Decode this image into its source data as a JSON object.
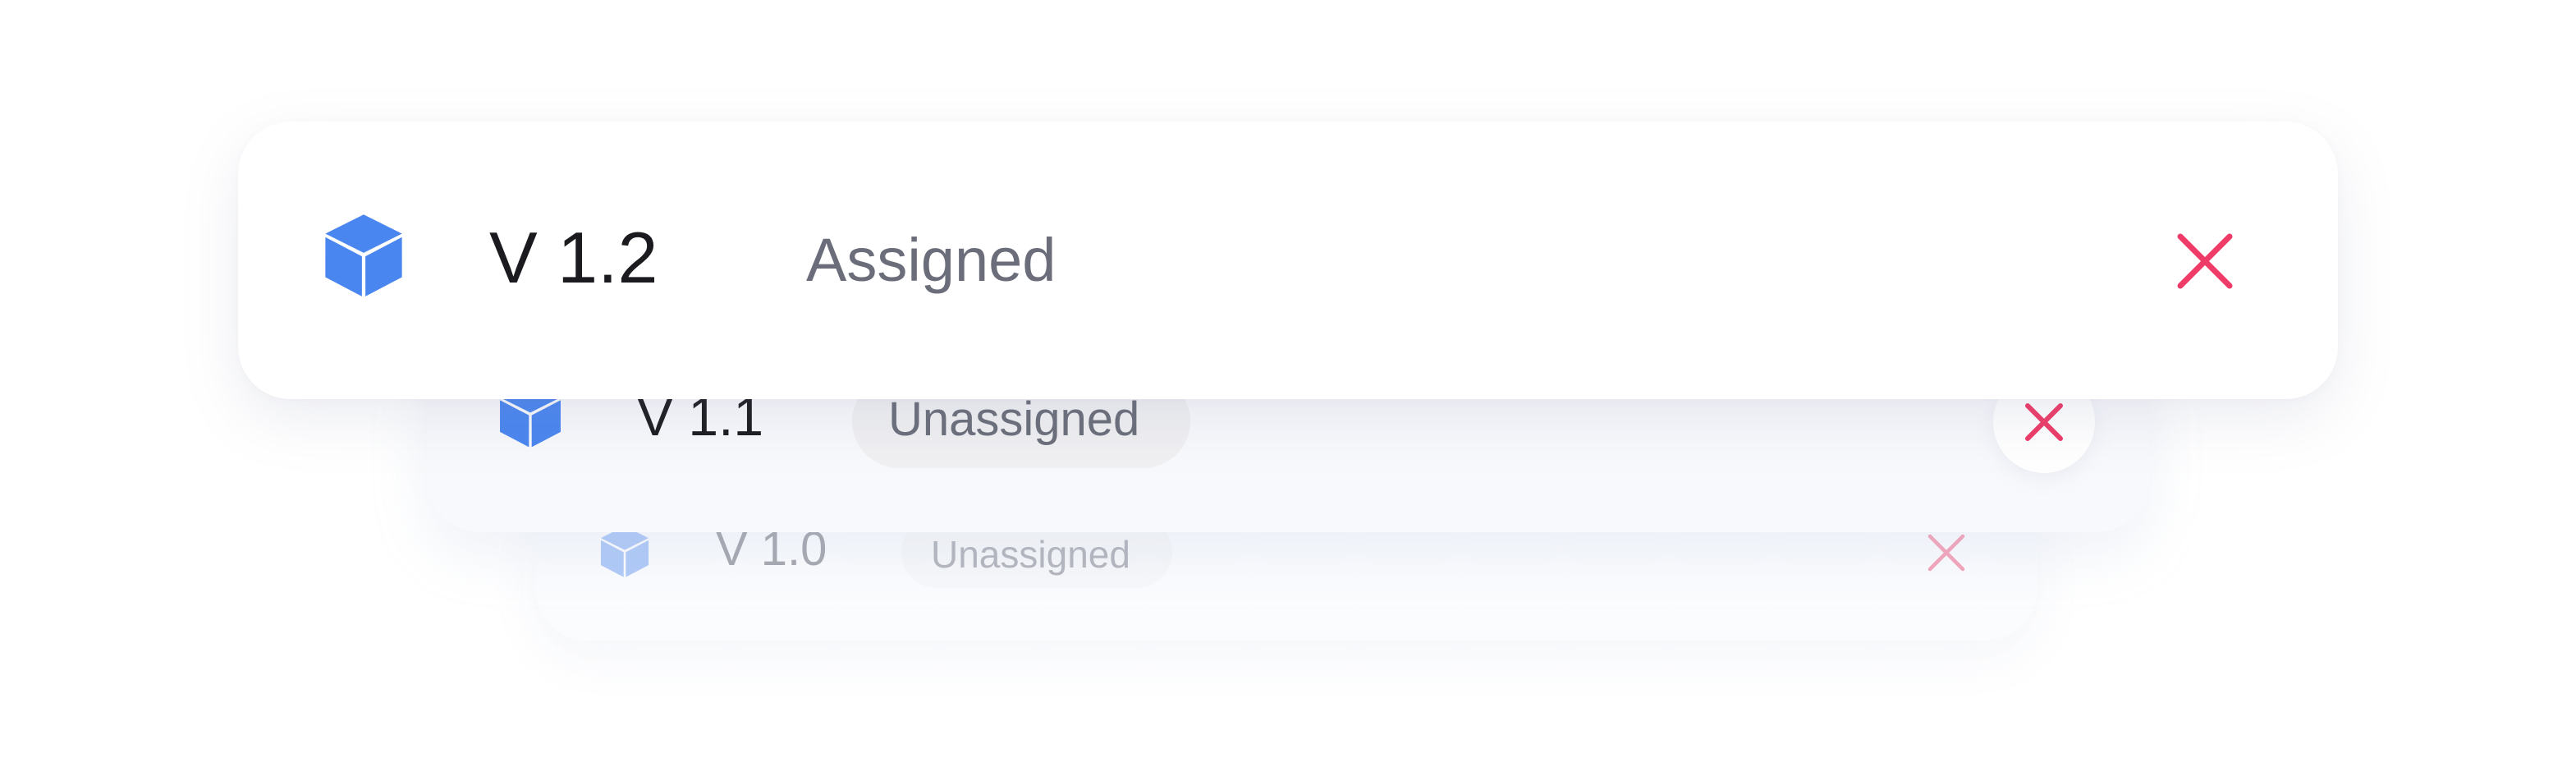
{
  "colors": {
    "accent_blue": "#4A86F0",
    "close_red": "#EE3B68",
    "text_dark": "#1b1b1f",
    "text_muted": "#6b6e7a",
    "pill_bg": "#f0f0f2"
  },
  "versions": [
    {
      "icon": "cube-icon",
      "label": "V 1.2",
      "status": "Assigned",
      "close_icon": "close-icon"
    },
    {
      "icon": "cube-icon",
      "label": "V 1.1",
      "status": "Unassigned",
      "close_icon": "close-icon"
    },
    {
      "icon": "cube-icon",
      "label": "V 1.0",
      "status": "Unassigned",
      "close_icon": "close-icon"
    }
  ]
}
